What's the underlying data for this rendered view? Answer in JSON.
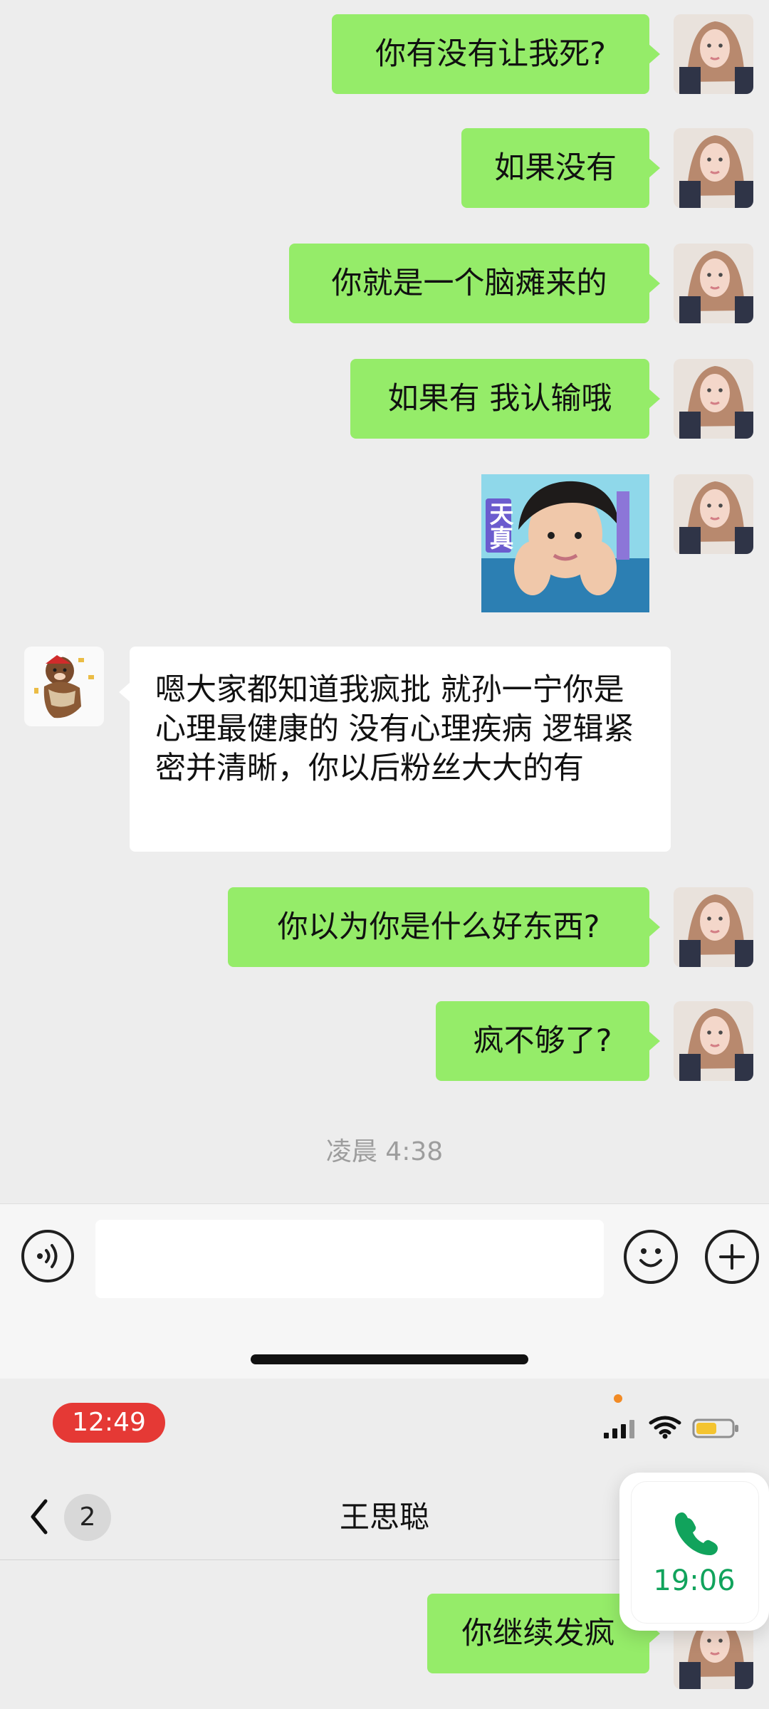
{
  "messages": [
    {
      "side": "right",
      "text": "你有没有让我死?"
    },
    {
      "side": "right",
      "text": "如果没有"
    },
    {
      "side": "right",
      "text": "你就是一个脑瘫来的"
    },
    {
      "side": "right",
      "text": "如果有 我认输哦"
    },
    {
      "side": "right",
      "sticker_text": "天真"
    },
    {
      "side": "left",
      "text": "嗯大家都知道我疯批 就孙一宁你是心理最健康的 没有心理疾病 逻辑紧密并清晰，你以后粉丝大大的有"
    },
    {
      "side": "right",
      "text": "你以为你是什么好东西?"
    },
    {
      "side": "right",
      "text": "疯不够了?"
    }
  ],
  "timestamp": "凌晨 4:38",
  "input": {
    "placeholder": ""
  },
  "status_bar": {
    "time": "12:49"
  },
  "nav": {
    "title": "王思聪",
    "badge": "2"
  },
  "call": {
    "duration": "19:06"
  },
  "last_message": {
    "text": "你继续发疯"
  },
  "colors": {
    "my_bubble": "#95ec69",
    "other_bubble": "#ffffff",
    "background": "#ededed",
    "status_time_bg": "#e53935",
    "call_green": "#11a35c"
  },
  "icons": {
    "voice": "voice-icon",
    "emoji": "emoji-icon",
    "plus": "plus-icon",
    "back": "back-icon",
    "phone": "phone-icon",
    "signal": "signal-icon",
    "wifi": "wifi-icon",
    "battery": "battery-icon"
  }
}
